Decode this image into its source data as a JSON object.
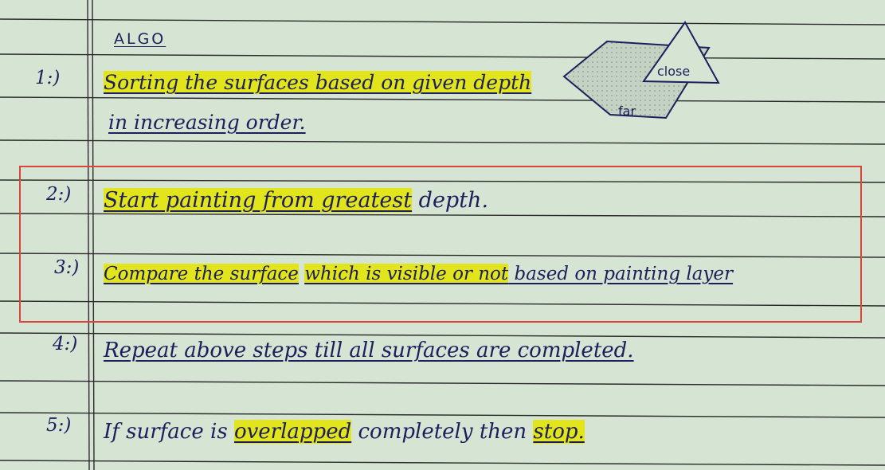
{
  "heading": "ALGO",
  "steps": [
    {
      "number": "1:)",
      "lines": [
        {
          "segments": [
            {
              "text": "Sorting the surfaces based on given depth",
              "highlight": true
            }
          ]
        },
        {
          "segments": [
            {
              "text": "in increasing order.",
              "highlight": false
            }
          ]
        }
      ]
    },
    {
      "number": "2:)",
      "lines": [
        {
          "segments": [
            {
              "text": "Start painting from greatest",
              "highlight": true
            },
            {
              "text": " depth.",
              "highlight": false
            }
          ]
        }
      ]
    },
    {
      "number": "3:)",
      "lines": [
        {
          "segments": [
            {
              "text": "Compare the surface",
              "highlight": true
            },
            {
              "text": "  ",
              "highlight": false
            },
            {
              "text": "which is visible or not",
              "highlight": true
            },
            {
              "text": " based on painting layer",
              "highlight": false
            }
          ]
        }
      ]
    },
    {
      "number": "4:)",
      "lines": [
        {
          "segments": [
            {
              "text": "Repeat above steps till all surfaces are completed.",
              "highlight": false
            }
          ]
        }
      ]
    },
    {
      "number": "5:)",
      "lines": [
        {
          "segments": [
            {
              "text": "If surface is ",
              "highlight": false
            },
            {
              "text": "overlapped",
              "highlight": true
            },
            {
              "text": " completely then ",
              "highlight": false
            },
            {
              "text": "stop.",
              "highlight": true
            }
          ]
        }
      ]
    }
  ],
  "sketch": {
    "label_close": "close",
    "label_far": "far"
  },
  "colors": {
    "paper": "#d6e4d4",
    "ink": "#1c1f5c",
    "highlight": "#e3e51c",
    "rule_line": "#2b2b2b",
    "selection_box": "#d9453a"
  }
}
